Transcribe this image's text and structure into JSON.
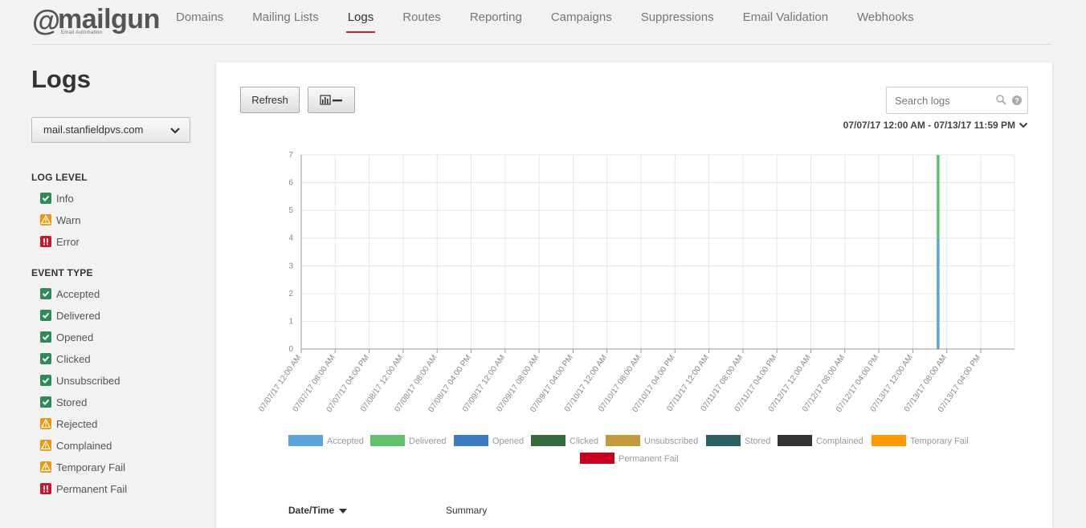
{
  "brand": {
    "name": "mailgun",
    "at": "@",
    "tagline": "Email Automation"
  },
  "nav": [
    {
      "label": "Domains",
      "active": false
    },
    {
      "label": "Mailing Lists",
      "active": false
    },
    {
      "label": "Logs",
      "active": true
    },
    {
      "label": "Routes",
      "active": false
    },
    {
      "label": "Reporting",
      "active": false
    },
    {
      "label": "Campaigns",
      "active": false
    },
    {
      "label": "Suppressions",
      "active": false
    },
    {
      "label": "Email Validation",
      "active": false
    },
    {
      "label": "Webhooks",
      "active": false
    }
  ],
  "sidebar": {
    "title": "Logs",
    "domain_select": "mail.stanfieldpvs.com",
    "log_level_heading": "LOG LEVEL",
    "log_levels": [
      {
        "label": "Info",
        "status": "ok"
      },
      {
        "label": "Warn",
        "status": "warn"
      },
      {
        "label": "Error",
        "status": "err"
      }
    ],
    "event_type_heading": "EVENT TYPE",
    "event_types": [
      {
        "label": "Accepted",
        "status": "ok"
      },
      {
        "label": "Delivered",
        "status": "ok"
      },
      {
        "label": "Opened",
        "status": "ok"
      },
      {
        "label": "Clicked",
        "status": "ok"
      },
      {
        "label": "Unsubscribed",
        "status": "ok"
      },
      {
        "label": "Stored",
        "status": "ok"
      },
      {
        "label": "Rejected",
        "status": "warn"
      },
      {
        "label": "Complained",
        "status": "warn"
      },
      {
        "label": "Temporary Fail",
        "status": "warn"
      },
      {
        "label": "Permanent Fail",
        "status": "err"
      }
    ]
  },
  "toolbar": {
    "refresh_label": "Refresh",
    "chart_toggle_icon": "bar-chart-collapse-icon",
    "search_placeholder": "Search logs",
    "date_range": "07/07/17 12:00 AM - 07/13/17 11:59 PM"
  },
  "chart_data": {
    "type": "bar",
    "stacked": true,
    "ylim": [
      0,
      7
    ],
    "yticks": [
      0,
      1,
      2,
      3,
      4,
      5,
      6,
      7
    ],
    "grid": true,
    "legend_position": "bottom",
    "x_ticks": [
      "07/07/17 12:00 AM",
      "07/07/17 08:00 AM",
      "07/07/17 04:00 PM",
      "07/08/17 12:00 AM",
      "07/08/17 08:00 AM",
      "07/08/17 04:00 PM",
      "07/09/17 12:00 AM",
      "07/09/17 08:00 AM",
      "07/09/17 04:00 PM",
      "07/10/17 12:00 AM",
      "07/10/17 08:00 AM",
      "07/10/17 04:00 PM",
      "07/11/17 12:00 AM",
      "07/11/17 08:00 AM",
      "07/11/17 04:00 PM",
      "07/12/17 12:00 AM",
      "07/12/17 08:00 AM",
      "07/12/17 04:00 PM",
      "07/13/17 12:00 AM",
      "07/13/17 08:00 AM",
      "07/13/17 04:00 PM"
    ],
    "bars": [
      {
        "x": "07/13/17 06:00 AM",
        "segments": [
          {
            "series": "Accepted",
            "value": 4
          },
          {
            "series": "Delivered",
            "value": 3
          }
        ]
      }
    ],
    "series": [
      {
        "name": "Accepted",
        "color": "#5aa6dc"
      },
      {
        "name": "Delivered",
        "color": "#62c16c"
      },
      {
        "name": "Opened",
        "color": "#3b7bc4"
      },
      {
        "name": "Clicked",
        "color": "#356b3d"
      },
      {
        "name": "Unsubscribed",
        "color": "#c49a3c"
      },
      {
        "name": "Stored",
        "color": "#2c5f63"
      },
      {
        "name": "Complained",
        "color": "#333333"
      },
      {
        "name": "Temporary Fail",
        "color": "#ff9900"
      },
      {
        "name": "Permanent Fail",
        "color": "#c8001e"
      }
    ]
  },
  "table": {
    "columns": [
      {
        "label": "Date/Time",
        "sorted": "desc"
      },
      {
        "label": "Summary"
      }
    ]
  }
}
